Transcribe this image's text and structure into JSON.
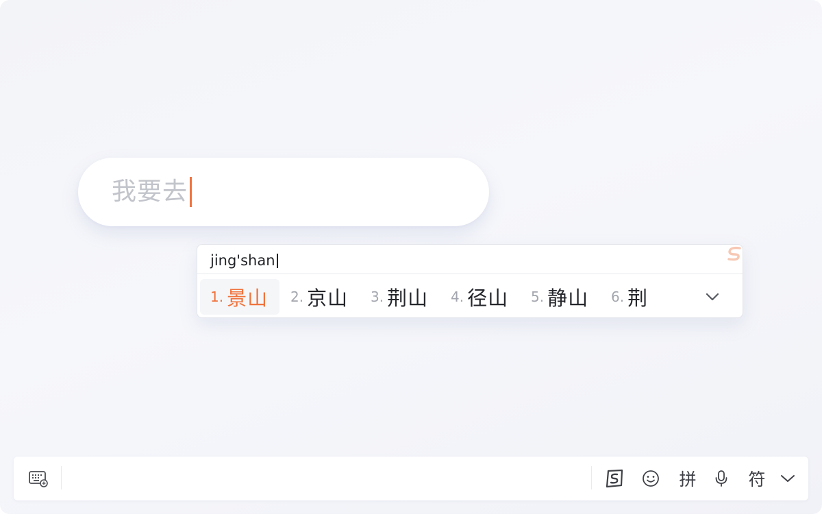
{
  "field": {
    "text": "我要去"
  },
  "ime": {
    "composition": "jing'shan",
    "candidates": [
      {
        "num": "1.",
        "word": "景山",
        "selected": true
      },
      {
        "num": "2.",
        "word": "京山",
        "selected": false
      },
      {
        "num": "3.",
        "word": "荆山",
        "selected": false
      },
      {
        "num": "4.",
        "word": "径山",
        "selected": false
      },
      {
        "num": "5.",
        "word": "静山",
        "selected": false
      },
      {
        "num": "6.",
        "word": "荆",
        "selected": false
      }
    ]
  },
  "toolbar": {
    "pinyin_label": "拼",
    "symbols_label": "符"
  },
  "colors": {
    "accent": "#f0733c",
    "caret": "#ef7440"
  },
  "icons": [
    "keyboard-icon",
    "sogou-logo-icon",
    "emoji-icon",
    "microphone-icon",
    "chevron-down-icon"
  ]
}
